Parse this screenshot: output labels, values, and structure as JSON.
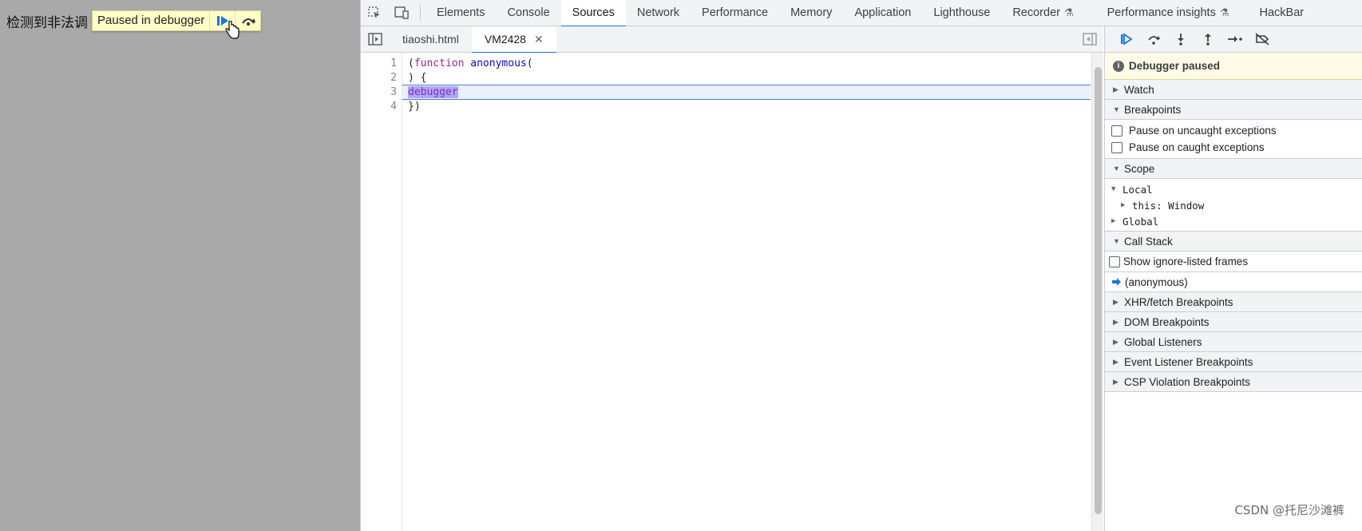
{
  "page": {
    "text": "检测到非法调",
    "overlay": {
      "paused_label": "Paused in debugger"
    }
  },
  "devtools": {
    "main_tabs": [
      {
        "label": "Elements"
      },
      {
        "label": "Console"
      },
      {
        "label": "Sources",
        "active": true
      },
      {
        "label": "Network"
      },
      {
        "label": "Performance"
      },
      {
        "label": "Memory"
      },
      {
        "label": "Application"
      },
      {
        "label": "Lighthouse"
      },
      {
        "label": "Recorder",
        "experimental": true
      },
      {
        "label": "Performance insights",
        "experimental": true
      },
      {
        "label": "HackBar"
      }
    ],
    "file_tabs": [
      {
        "label": "tiaoshi.html"
      },
      {
        "label": "VM2428",
        "active": true,
        "closable": true
      }
    ],
    "code": {
      "line_numbers": [
        "1",
        "2",
        "3",
        "4"
      ],
      "lines": [
        "(function anonymous(",
        ") {",
        "debugger",
        "})"
      ],
      "highlighted_line": 3
    },
    "debugger": {
      "paused_banner": "Debugger paused",
      "sections": {
        "watch": "Watch",
        "breakpoints": "Breakpoints",
        "pause_uncaught": "Pause on uncaught exceptions",
        "pause_caught": "Pause on caught exceptions",
        "scope": "Scope",
        "scope_local": "Local",
        "scope_this": "this: Window",
        "scope_global": "Global",
        "call_stack": "Call Stack",
        "show_ignore_listed": "Show ignore-listed frames",
        "frame_anonymous": "(anonymous)",
        "xhr": "XHR/fetch Breakpoints",
        "dom": "DOM Breakpoints",
        "global_listeners": "Global Listeners",
        "event_listener": "Event Listener Breakpoints",
        "csp": "CSP Violation Breakpoints"
      }
    }
  },
  "watermark": "CSDN @托尼沙滩裤",
  "colors": {
    "accent": "#1a73e8",
    "paused_bg": "#fffbe6",
    "page_bg": "#a9a9a9"
  }
}
